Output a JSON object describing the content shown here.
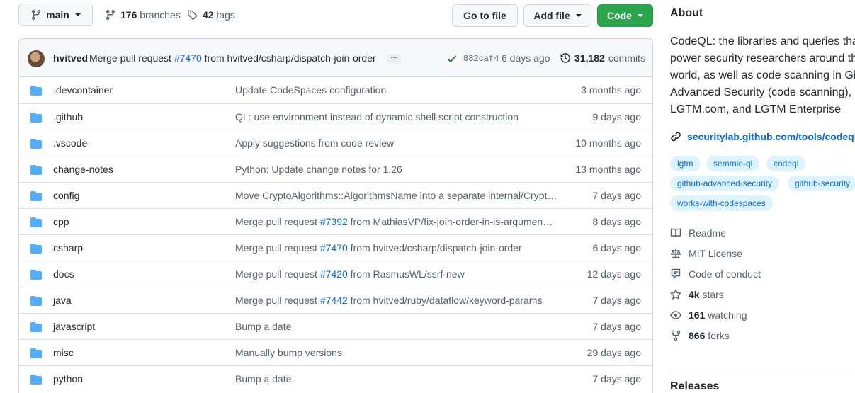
{
  "toolbar": {
    "branch": "main",
    "branches_count": "176",
    "branches_label": "branches",
    "tags_count": "42",
    "tags_label": "tags",
    "goto_file": "Go to file",
    "add_file": "Add file",
    "code": "Code"
  },
  "commit": {
    "author": "hvitved",
    "message_prefix": "Merge pull request",
    "pr": "#7470",
    "message_suffix": "from hvitved/csharp/dispatch-join-order",
    "ellipsis": "…",
    "sha": "882caf4",
    "age": "6 days ago",
    "commits_count": "31,182",
    "commits_label": "commits"
  },
  "files": [
    {
      "name": ".devcontainer",
      "message": "Update CodeSpaces configuration",
      "age": "3 months ago"
    },
    {
      "name": ".github",
      "message": "QL: use environment instead of dynamic shell script construction",
      "age": "9 days ago"
    },
    {
      "name": ".vscode",
      "message": "Apply suggestions from code review",
      "age": "10 months ago"
    },
    {
      "name": "change-notes",
      "message": "Python: Update change notes for 1.26",
      "age": "13 months ago"
    },
    {
      "name": "config",
      "message": "Move CryptoAlgorithms::AlgorithmsName into a separate internal/Crypt…",
      "age": "7 days ago"
    },
    {
      "name": "cpp",
      "message_prefix": "Merge pull request",
      "pr": "#7392",
      "message_suffix": "from MathiasVP/fix-join-order-in-is-argumen…",
      "age": "8 days ago"
    },
    {
      "name": "csharp",
      "message_prefix": "Merge pull request",
      "pr": "#7470",
      "message_suffix": "from hvitved/csharp/dispatch-join-order",
      "age": "6 days ago"
    },
    {
      "name": "docs",
      "message_prefix": "Merge pull request",
      "pr": "#7420",
      "message_suffix": "from RasmusWL/ssrf-new",
      "age": "12 days ago"
    },
    {
      "name": "java",
      "message_prefix": "Merge pull request",
      "pr": "#7442",
      "message_suffix": "from hvitved/ruby/dataflow/keyword-params",
      "age": "7 days ago"
    },
    {
      "name": "javascript",
      "message": "Bump a date",
      "age": "7 days ago"
    },
    {
      "name": "misc",
      "message": "Manually bump versions",
      "age": "29 days ago"
    },
    {
      "name": "python",
      "message": "Bump a date",
      "age": "7 days ago"
    }
  ],
  "about": {
    "title": "About",
    "desc_lines": [
      "CodeQL: the libraries and queries tha",
      "power security researchers around th",
      "world, as well as code scanning in Git",
      "Advanced Security (code scanning),",
      "LGTM.com, and LGTM Enterprise"
    ],
    "website": "securitylab.github.com/tools/codeql",
    "topics": [
      "lgtm",
      "semmle-ql",
      "codeql",
      "github-advanced-security",
      "github-security",
      "works-with-codespaces"
    ],
    "readme": "Readme",
    "license": "MIT License",
    "conduct": "Code of conduct",
    "stars_count": "4k",
    "stars_label": "stars",
    "watching_count": "161",
    "watching_label": "watching",
    "forks_count": "866",
    "forks_label": "forks",
    "releases": "Releases"
  },
  "colors": {
    "accent": "#0969da",
    "code_button": "#2da44e",
    "folder": "#54aeff",
    "success": "#1a7f37"
  }
}
